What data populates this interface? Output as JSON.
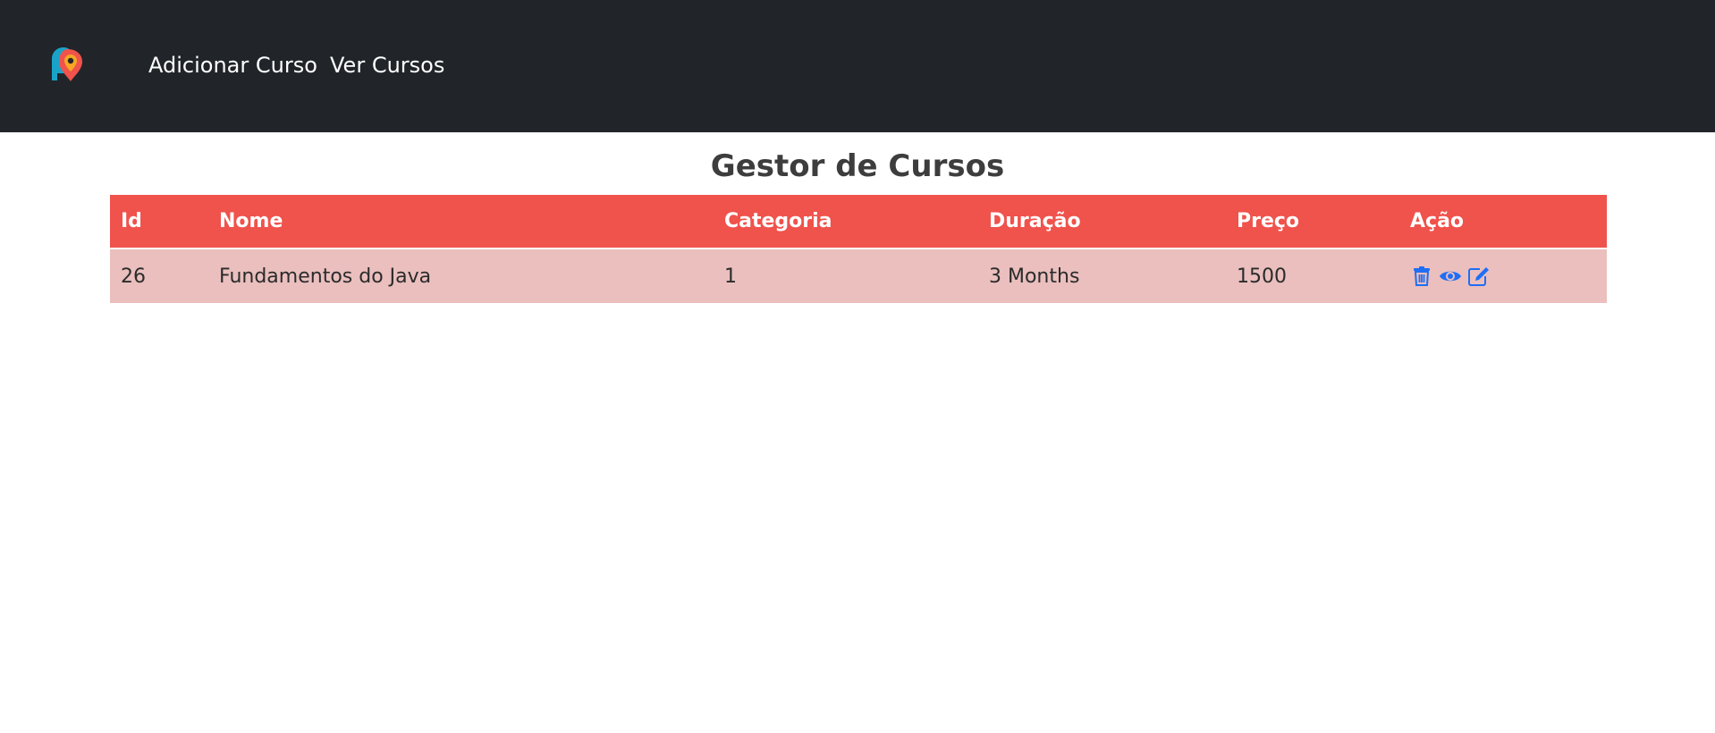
{
  "navbar": {
    "links": [
      {
        "label": "Adicionar Curso"
      },
      {
        "label": "Ver Cursos"
      }
    ],
    "background": "#212529"
  },
  "page": {
    "title": "Gestor de Cursos"
  },
  "table": {
    "header_color": "#f0524c",
    "row_color": "#eabfbe",
    "columns": [
      "Id",
      "Nome",
      "Categoria",
      "Duração",
      "Preço",
      "Ação"
    ],
    "rows": [
      {
        "id": "26",
        "nome": "Fundamentos do Java",
        "categoria": "1",
        "duracao": "3 Months",
        "preco": "1500",
        "actions": [
          "trash-icon",
          "eye-icon",
          "edit-icon"
        ]
      }
    ]
  },
  "action_icon_color": "#1f6ef5"
}
